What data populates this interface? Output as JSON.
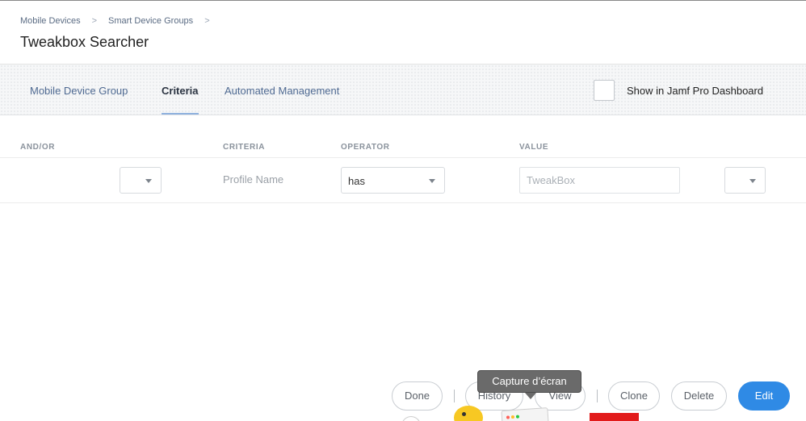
{
  "breadcrumb": {
    "items": [
      "Mobile Devices",
      "Smart Device Groups"
    ],
    "separator": ">"
  },
  "page": {
    "title": "Tweakbox Searcher"
  },
  "tabs": [
    {
      "label": "Mobile Device Group",
      "active": false
    },
    {
      "label": "Criteria",
      "active": true
    },
    {
      "label": "Automated Management",
      "active": false
    }
  ],
  "dashboard": {
    "label": "Show in Jamf Pro Dashboard",
    "checked": false
  },
  "criteria_table": {
    "headers": {
      "and_or": "AND/OR",
      "criteria": "CRITERIA",
      "operator": "OPERATOR",
      "value": "VALUE"
    },
    "rows": [
      {
        "and_or": "",
        "criteria": "Profile Name",
        "operator": "has",
        "value_placeholder": "TweakBox",
        "paren": ""
      }
    ]
  },
  "actions": {
    "done": "Done",
    "history": "History",
    "view": "View",
    "clone": "Clone",
    "delete": "Delete",
    "edit": "Edit"
  },
  "tooltip": {
    "text": "Capture d’écran"
  },
  "colors": {
    "primary": "#2f8ae5",
    "link": "#4f6a92",
    "tab_underline": "#8fb2de"
  }
}
